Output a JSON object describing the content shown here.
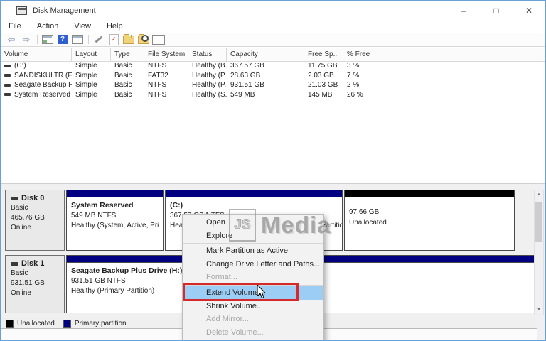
{
  "window": {
    "title": "Disk Management",
    "controls": {
      "minimize": "–",
      "maximize": "□",
      "close": "✕"
    }
  },
  "menu_bar": {
    "items": [
      "File",
      "Action",
      "View",
      "Help"
    ]
  },
  "toolbar": {
    "buttons": [
      "back-arrow",
      "forward-arrow",
      "console-window",
      "help",
      "console-window-alt",
      "wrench",
      "document-check",
      "folder-up",
      "folder-magnifier",
      "list-details"
    ],
    "glyphs": {
      "back": "⇦",
      "forward": "⇨",
      "help": "?",
      "check": "✓",
      "up": "↑"
    }
  },
  "volume_table": {
    "columns": [
      "Volume",
      "Layout",
      "Type",
      "File System",
      "Status",
      "Capacity",
      "Free Sp...",
      "% Free"
    ],
    "rows": [
      {
        "volume": "(C:)",
        "layout": "Simple",
        "type": "Basic",
        "file_system": "NTFS",
        "status": "Healthy (B...",
        "capacity": "367.57 GB",
        "free_space": "11.75 GB",
        "percent_free": "3 %"
      },
      {
        "volume": "SANDISKULTR (F:)",
        "layout": "Simple",
        "type": "Basic",
        "file_system": "FAT32",
        "status": "Healthy (P...",
        "capacity": "28.63 GB",
        "free_space": "2.03 GB",
        "percent_free": "7 %"
      },
      {
        "volume": "Seagate Backup Pl...",
        "layout": "Simple",
        "type": "Basic",
        "file_system": "NTFS",
        "status": "Healthy (P...",
        "capacity": "931.51 GB",
        "free_space": "21.03 GB",
        "percent_free": "2 %"
      },
      {
        "volume": "System Reserved",
        "layout": "Simple",
        "type": "Basic",
        "file_system": "NTFS",
        "status": "Healthy (S...",
        "capacity": "549 MB",
        "free_space": "145 MB",
        "percent_free": "26 %"
      }
    ]
  },
  "disks": [
    {
      "name": "Disk 0",
      "kind": "Basic",
      "size": "465.76 GB",
      "state": "Online",
      "partitions": [
        {
          "name": "System Reserved",
          "size_fs": "549 MB NTFS",
          "status": "Healthy (System, Active, Pri"
        },
        {
          "name": "(C:)",
          "size_fs": "367.57 GB NTFS",
          "status": "Healthy (Boot, Page File, Crash Dump, Primary Partition)"
        },
        {
          "name": "",
          "size_fs": "97.66 GB",
          "status": "Unallocated"
        }
      ]
    },
    {
      "name": "Disk 1",
      "kind": "Basic",
      "size": "931.51 GB",
      "state": "Online",
      "partitions": [
        {
          "name": "Seagate Backup Plus Drive  (H:)",
          "size_fs": "931.51 GB NTFS",
          "status": "Healthy (Primary Partition)"
        }
      ]
    }
  ],
  "legend": {
    "items": [
      {
        "label": "Unallocated",
        "color": "#000000"
      },
      {
        "label": "Primary partition",
        "color": "#000080"
      }
    ]
  },
  "context_menu": {
    "items": [
      {
        "label": "Open",
        "enabled": true
      },
      {
        "label": "Explore",
        "enabled": true
      },
      {
        "label": "Mark Partition as Active",
        "enabled": true
      },
      {
        "label": "Change Drive Letter and Paths...",
        "enabled": true
      },
      {
        "label": "Format...",
        "enabled": false
      },
      {
        "label": "Extend Volume...",
        "enabled": true,
        "highlighted": true
      },
      {
        "label": "Shrink Volume...",
        "enabled": true
      },
      {
        "label": "Add Mirror...",
        "enabled": false
      },
      {
        "label": "Delete Volume...",
        "enabled": false
      }
    ]
  },
  "scrollbar": {
    "up": "▲",
    "down": "▼"
  },
  "watermark": {
    "initials": "JS",
    "name": "Media"
  },
  "colors": {
    "primary_partition": "#000080",
    "unallocated": "#000000",
    "menu_highlight": "#9ccef5",
    "annotation_red": "#d42a2a"
  }
}
